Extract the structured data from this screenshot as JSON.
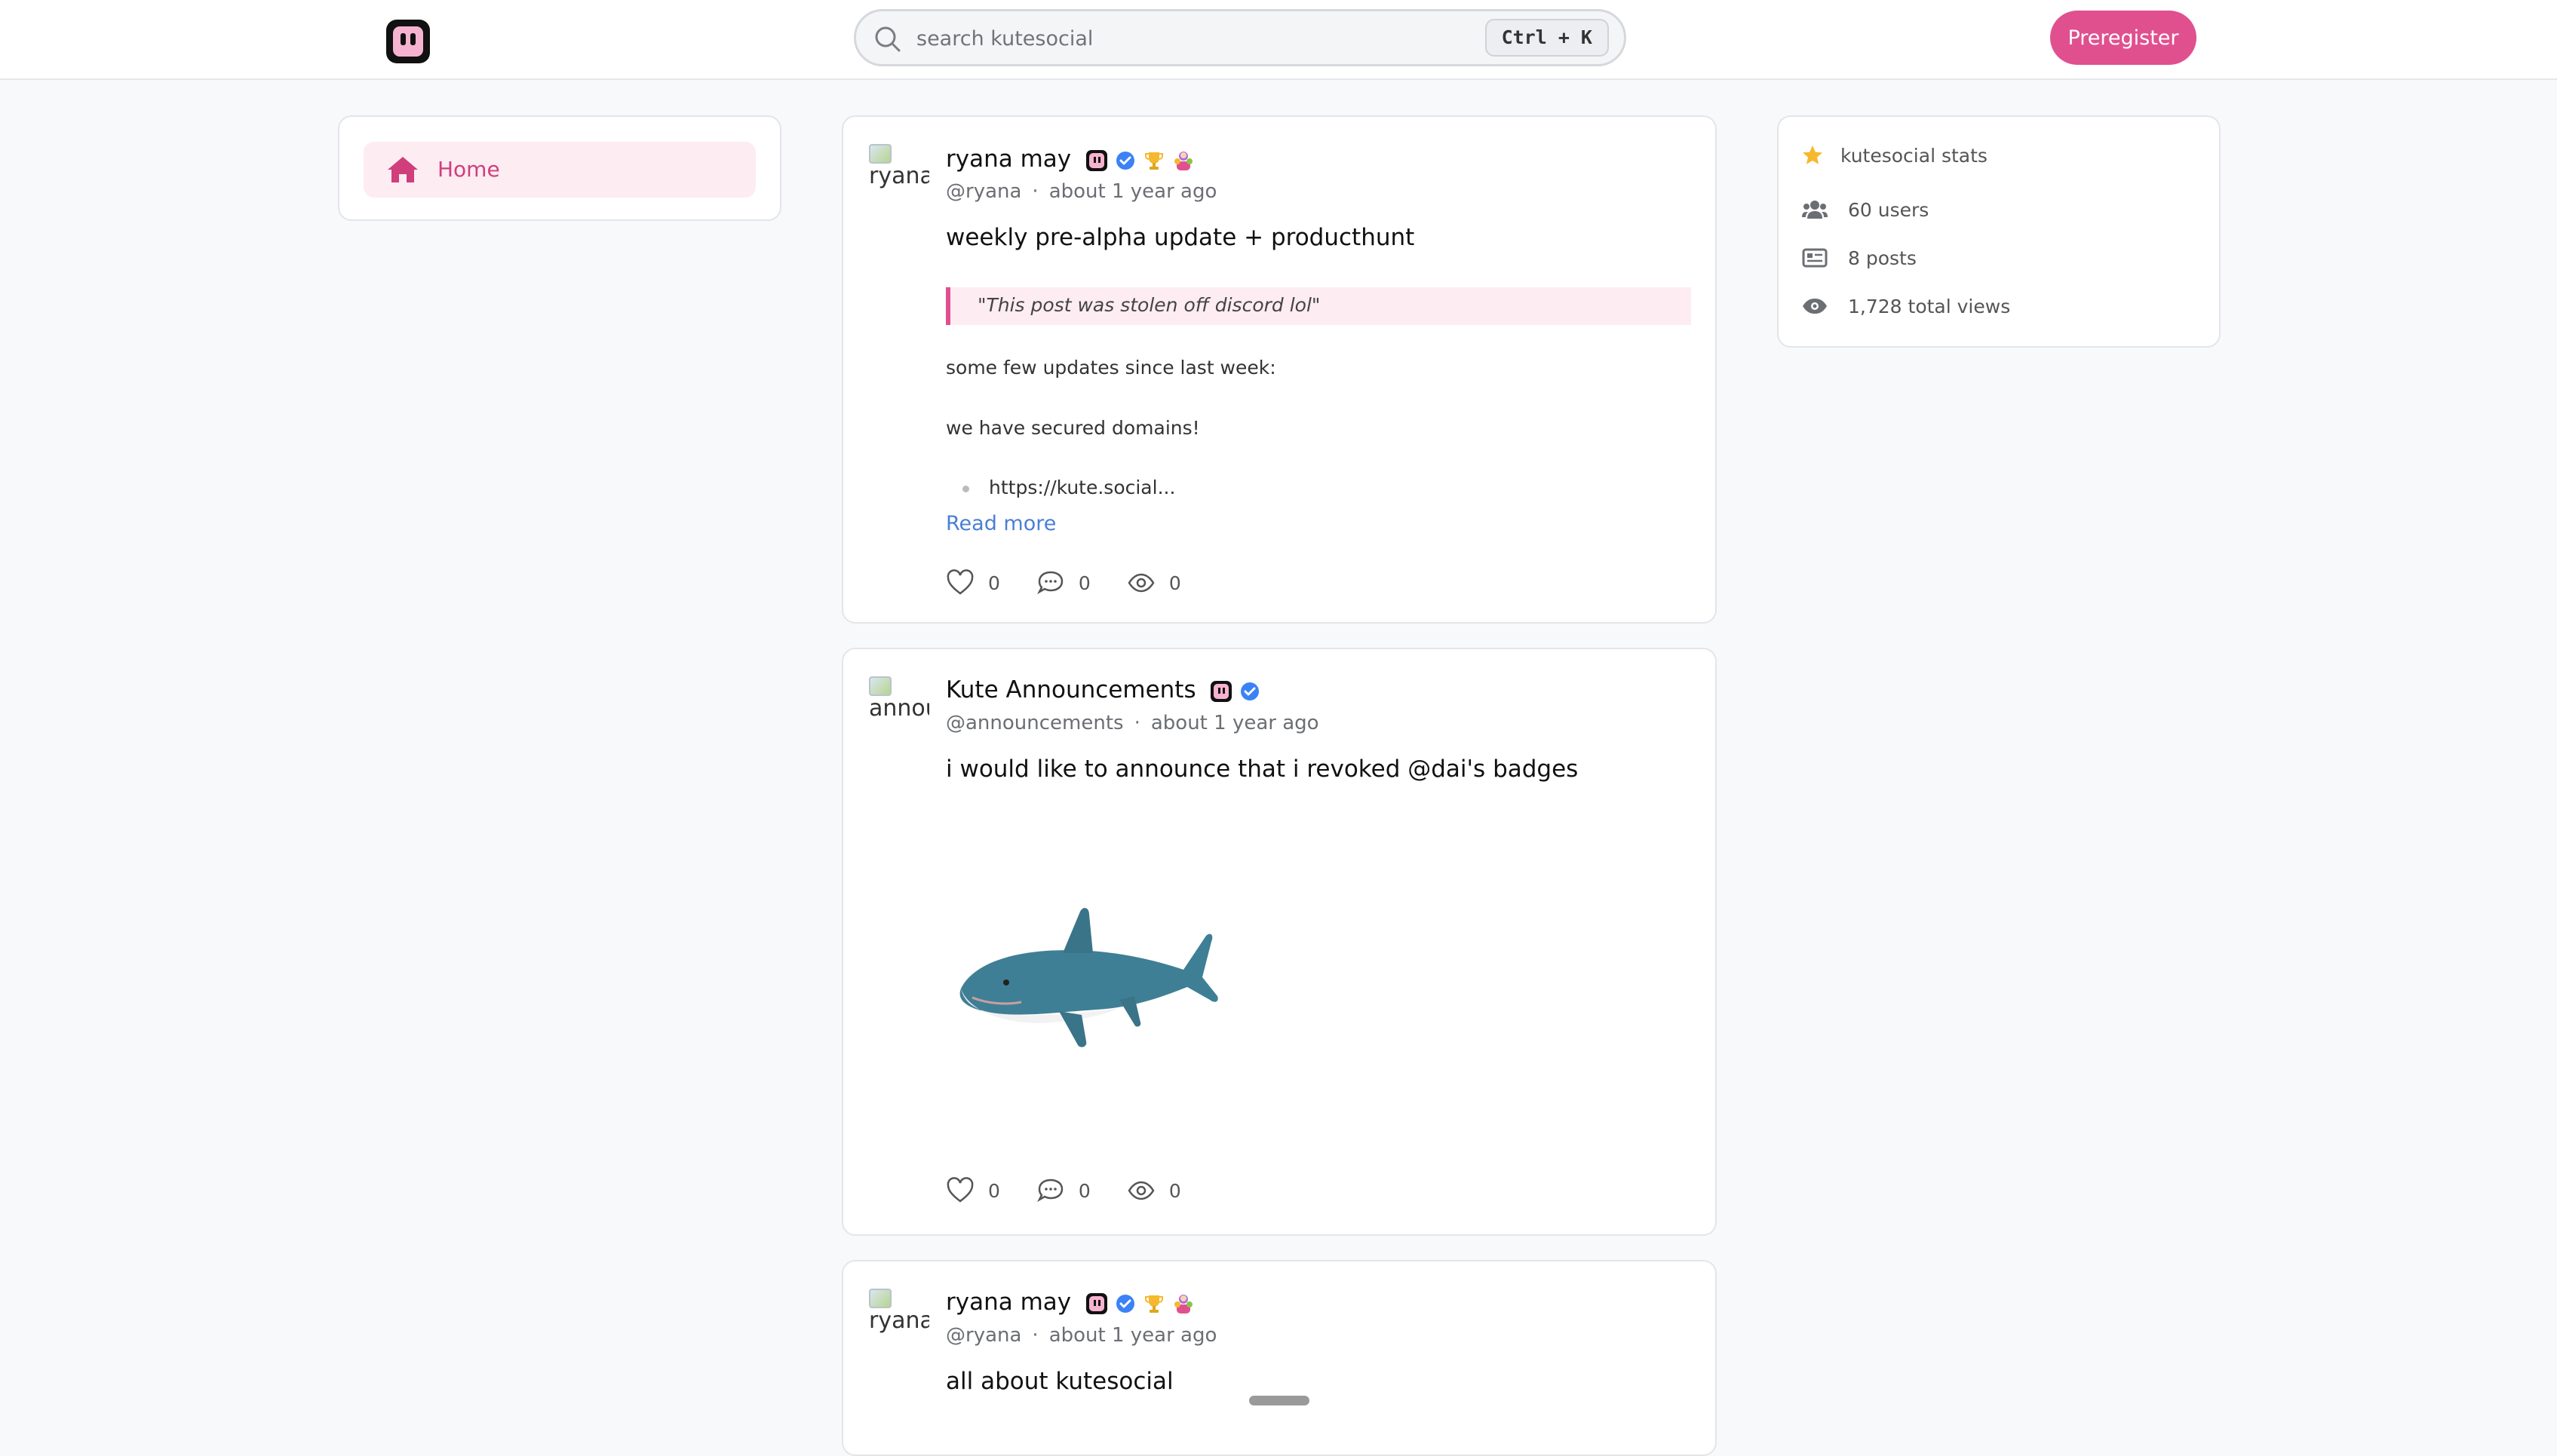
{
  "header": {
    "search_placeholder": "search kutesocial",
    "shortcut": "Ctrl + K",
    "preregister_label": "Preregister"
  },
  "sidebar": {
    "items": [
      {
        "label": "Home",
        "active": true,
        "icon": "home-icon"
      }
    ]
  },
  "posts": [
    {
      "avatar_alt": "ryana",
      "name": "ryana may",
      "handle": "@ryana",
      "time": "about 1 year ago",
      "badges": [
        "kute-badge-icon",
        "verified-icon",
        "trophy-icon",
        "people-icon"
      ],
      "title": "weekly pre-alpha update + producthunt",
      "quote": "\"This post was stolen off discord lol\"",
      "paragraphs": [
        "some few updates since last week:",
        "we have secured domains!"
      ],
      "list_item": "https://kute.social...",
      "read_more": "Read more",
      "likes": "0",
      "comments": "0",
      "views": "0"
    },
    {
      "avatar_alt": "annou",
      "name": "Kute Announcements",
      "handle": "@announcements",
      "time": "about 1 year ago",
      "badges": [
        "kute-badge-icon",
        "verified-icon"
      ],
      "title": "i would like to announce that i revoked @dai's badges",
      "image": "shark-plush-image",
      "likes": "0",
      "comments": "0",
      "views": "0"
    },
    {
      "avatar_alt": "ryana",
      "name": "ryana may",
      "handle": "@ryana",
      "time": "about 1 year ago",
      "badges": [
        "kute-badge-icon",
        "verified-icon",
        "trophy-icon",
        "people-icon"
      ],
      "title": "all about kutesocial"
    }
  ],
  "stats": {
    "title": "kutesocial stats",
    "users": "60 users",
    "posts": "8 posts",
    "views": "1,728 total views"
  },
  "colors": {
    "accent": "#e0508f",
    "accent_soft": "#fdecf2",
    "link": "#4a7fd6",
    "verified": "#3b82f6",
    "star": "#f5b82e"
  }
}
